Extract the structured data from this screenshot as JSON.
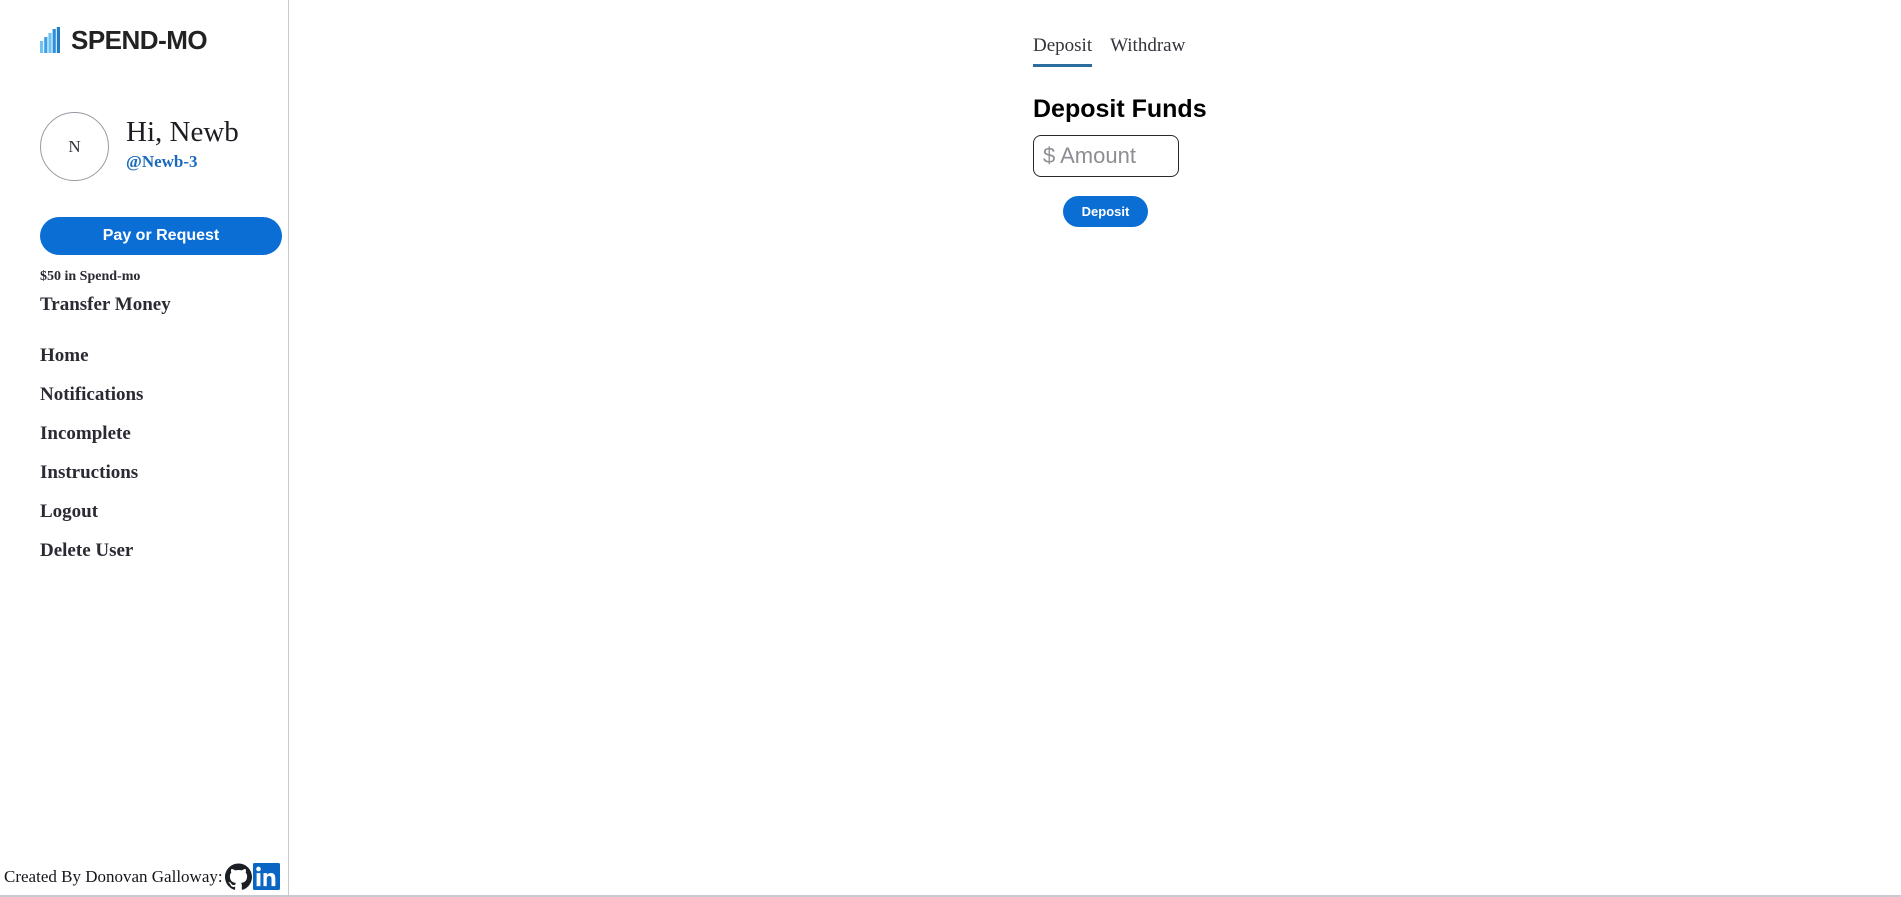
{
  "brand": {
    "name": "SPEND-MO",
    "icon": "bar-chart-icon",
    "icon_color": "#3aa0e8"
  },
  "sidebar": {
    "profile": {
      "avatar_initial": "N",
      "greeting": "Hi, Newb",
      "handle": "@Newb-3",
      "handle_color": "#1b6bbd"
    },
    "pay_button": "Pay or Request",
    "balance": "$50 in Spend-mo",
    "transfer_link": "Transfer Money",
    "nav_items": [
      {
        "label": "Home"
      },
      {
        "label": "Notifications"
      },
      {
        "label": "Incomplete"
      },
      {
        "label": "Instructions"
      },
      {
        "label": "Logout"
      },
      {
        "label": "Delete User"
      }
    ]
  },
  "footer": {
    "credit": "Created By Donovan Galloway:",
    "icons": [
      {
        "name": "github-icon",
        "color": "#1b1f23"
      },
      {
        "name": "linkedin-icon",
        "color": "#0a66c2"
      }
    ]
  },
  "main": {
    "tabs": [
      {
        "label": "Deposit",
        "active": true
      },
      {
        "label": "Withdraw",
        "active": false
      }
    ],
    "active_tab_underline_color": "#2b6d9e",
    "title": "Deposit Funds",
    "amount_field": {
      "value": "",
      "placeholder": "$ Amount"
    },
    "submit_button": "Deposit",
    "accent_color": "#0a6ed4"
  }
}
